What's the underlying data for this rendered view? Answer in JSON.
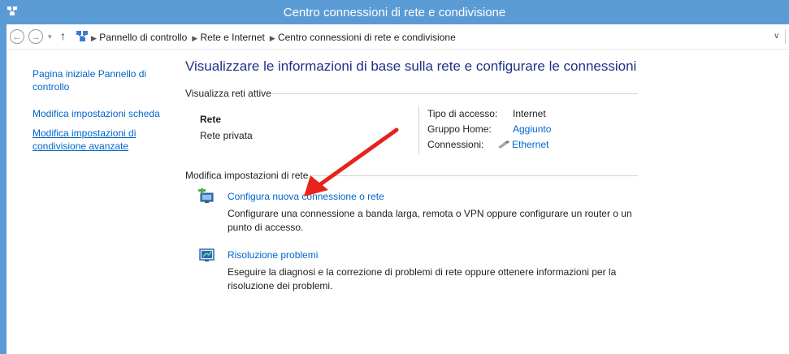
{
  "window": {
    "title": "Centro connessioni di rete e condivisione"
  },
  "address": {
    "breadcrumbs": [
      "Pannello di controllo",
      "Rete e Internet",
      "Centro connessioni di rete e condivisione"
    ]
  },
  "sidebar": {
    "home_line1": "Pagina iniziale Pannello di",
    "home_line2": "controllo",
    "adapter_settings": "Modifica impostazioni scheda",
    "sharing_line1": "Modifica impostazioni di",
    "sharing_line2": "condivisione avanzate"
  },
  "main": {
    "heading": "Visualizzare le informazioni di base sulla rete e configurare le connessioni",
    "active_networks_label": "Visualizza reti attive",
    "network": {
      "name": "Rete",
      "profile": "Rete privata",
      "access_label": "Tipo di accesso:",
      "access_value": "Internet",
      "homegroup_label": "Gruppo Home:",
      "homegroup_value": "Aggiunto",
      "connections_label": "Connessioni:",
      "connections_value": "Ethernet"
    },
    "change_settings_label": "Modifica impostazioni di rete",
    "tasks": [
      {
        "title": "Configura nuova connessione o rete",
        "desc_line1": "Configurare una connessione a banda larga, remota o VPN oppure configurare un router o un",
        "desc_line2": "punto di accesso."
      },
      {
        "title": "Risoluzione problemi",
        "desc_line1": "Eseguire la diagnosi e la correzione di problemi di rete oppure ottenere informazioni per la",
        "desc_line2": "risoluzione dei problemi."
      }
    ]
  },
  "colors": {
    "titlebar": "#5b9bd5",
    "link": "#0066cc",
    "heading": "#1e3287",
    "annotation_arrow": "#e8231c"
  },
  "icons": [
    "network-icon",
    "back-icon",
    "forward-icon",
    "up-arrow-icon",
    "new-connection-icon",
    "troubleshoot-icon",
    "ethernet-icon",
    "red-arrow-annotation"
  ]
}
